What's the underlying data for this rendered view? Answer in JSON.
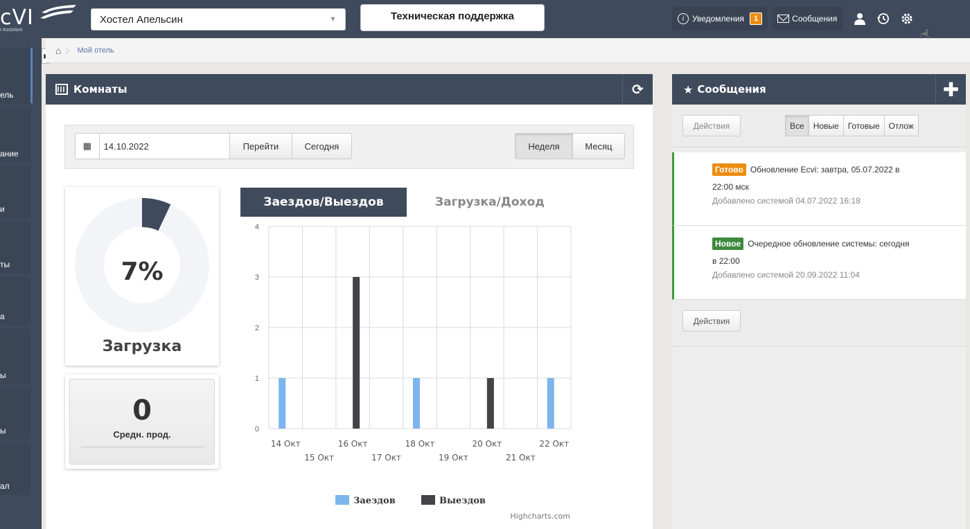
{
  "logo": {
    "text": "cVI",
    "sub": "r Assistant"
  },
  "header": {
    "hotel": "Хостел Апельсин",
    "support": "Техническая поддержка",
    "notifications_label": "Уведомления",
    "notifications_count": "1",
    "messages_label": "Сообщения"
  },
  "sidebar": {
    "items": [
      {
        "label": "ель"
      },
      {
        "label": "ание"
      },
      {
        "label": "и"
      },
      {
        "label": "ты"
      },
      {
        "label": "а"
      },
      {
        "label": "ы"
      },
      {
        "label": "ы"
      },
      {
        "label": "ал"
      }
    ]
  },
  "breadcrumb": {
    "current": "Мой отель"
  },
  "rooms": {
    "title": "Комнаты",
    "date": "14.10.2022",
    "go_label": "Перейти",
    "today_label": "Сегодня",
    "week_label": "Неделя",
    "month_label": "Месяц",
    "load_value": 7,
    "load_text": "7%",
    "load_label": "Загрузка",
    "avg_value": "0",
    "avg_label": "Средн. прод.",
    "tab_active": "Заездов/Выездов",
    "tab_inactive": "Загрузка/Доход"
  },
  "chart_data": {
    "type": "bar",
    "categories": [
      "14 Окт",
      "15 Окт",
      "16 Окт",
      "17 Окт",
      "18 Окт",
      "19 Окт",
      "20 Окт",
      "21 Окт",
      "22 Окт"
    ],
    "series": [
      {
        "name": "Заездов",
        "color": "#7cb5ec",
        "values": [
          1,
          0,
          0,
          0,
          1,
          0,
          0,
          0,
          1
        ]
      },
      {
        "name": "Выездов",
        "color": "#434348",
        "values": [
          0,
          0,
          3,
          0,
          0,
          0,
          1,
          0,
          0
        ]
      }
    ],
    "ylim": [
      0,
      4
    ],
    "yticks": [
      "0",
      "1",
      "2",
      "3",
      "4"
    ],
    "credit": "Highcharts.com",
    "legend": "bottom-center",
    "grid": true
  },
  "messages": {
    "title": "Сообщения",
    "actions_label": "Действия",
    "filters": [
      "Все",
      "Новые",
      "Готовые",
      "Отлож"
    ],
    "items": [
      {
        "status": "Готово",
        "text_1": "Обновление Ecvi: завтра, 05.07.2022 в",
        "text_2": "22:00 мск",
        "meta": "Добавлено системой 04.07.2022 16:18"
      },
      {
        "status": "Новое",
        "text_1": "Очередное обновление системы: сегодня",
        "text_2": "в 22:00",
        "meta": "Добавлено системой 20.09.2022 11:04"
      }
    ],
    "bottom_actions_label": "Действия"
  }
}
